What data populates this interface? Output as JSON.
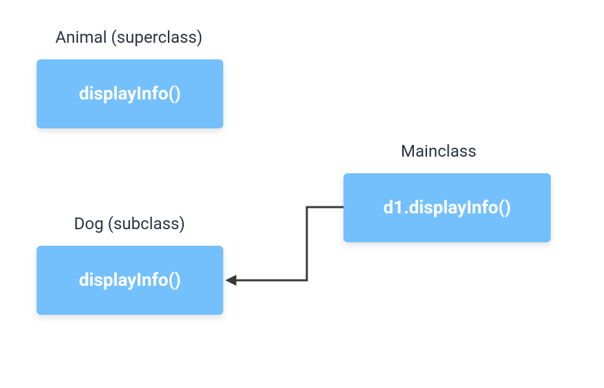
{
  "labels": {
    "animal": "Animal (superclass)",
    "dog": "Dog (subclass)",
    "mainclass": "Mainclass"
  },
  "boxes": {
    "animal_method": "displayInfo()",
    "dog_method": "displayInfo()",
    "mainclass_call": "d1.displayInfo()"
  },
  "colors": {
    "box_bg": "#74c0fc",
    "box_text": "#ffffff",
    "label_text": "#2d3440",
    "arrow": "#3a3a3a"
  }
}
